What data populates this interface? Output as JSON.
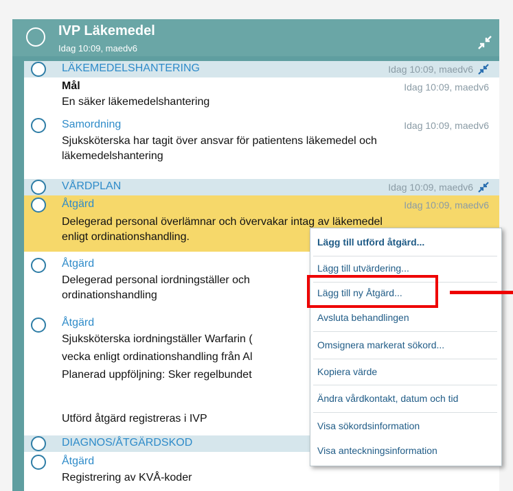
{
  "header": {
    "title": "IVP Läkemedel",
    "subtitle": "Idag 10:09, maedv6"
  },
  "rows": [
    {
      "title": "LÄKEMEDELSHANTERING",
      "meta": "Idag 10:09, maedv6"
    },
    {
      "title": "Mål",
      "meta": "Idag 10:09, maedv6",
      "text": "En säker läkemedelshantering"
    },
    {
      "title": "Samordning",
      "meta": "Idag 10:09, maedv6",
      "text_lines": [
        "Sjuksköterska har tagit över ansvar för patientens läkemedel och",
        "läkemedelshantering"
      ]
    },
    {
      "title": "VÅRDPLAN",
      "meta": "Idag 10:09, maedv6"
    },
    {
      "title": "Åtgärd",
      "meta": "Idag 10:09, maedv6",
      "text_lines": [
        "Delegerad personal överlämnar och övervakar intag av läkemedel",
        "enligt ordinationshandling."
      ]
    },
    {
      "title": "Åtgärd",
      "text_lines": [
        "Delegerad personal iordningställer och",
        "ordinationshandling"
      ]
    },
    {
      "title": "Åtgärd",
      "text_lines": [
        "Sjuksköterska iordningställer Warfarin (",
        "vecka enligt ordinationshandling från Al",
        "Planerad uppföljning: Sker regelbundet",
        "",
        "Utförd åtgärd registreras i IVP"
      ]
    },
    {
      "title": "DIAGNOS/ÅTGÄRDSKOD"
    },
    {
      "title": "Åtgärd",
      "text": "Registrering av KVÅ-koder"
    }
  ],
  "context_menu": {
    "items": [
      "Lägg till utförd åtgärd...",
      "Lägg till utvärdering...",
      "Lägg till ny Åtgärd...",
      "Avsluta behandlingen",
      "Omsignera markerat sökord...",
      "Kopiera värde",
      "Ändra vårdkontakt, datum och tid",
      "Visa sökordsinformation",
      "Visa anteckningsinformation"
    ]
  },
  "colors": {
    "panel_teal": "#5f9ea0",
    "section_band": "#d6e6ec",
    "highlight": "#f6d86a",
    "link_blue": "#2e8bc9",
    "annotation_red": "#ee0000"
  },
  "icons": {
    "collapse": "collapse-arrows-icon",
    "pin": "pin-icon",
    "status": "circle-icon"
  }
}
